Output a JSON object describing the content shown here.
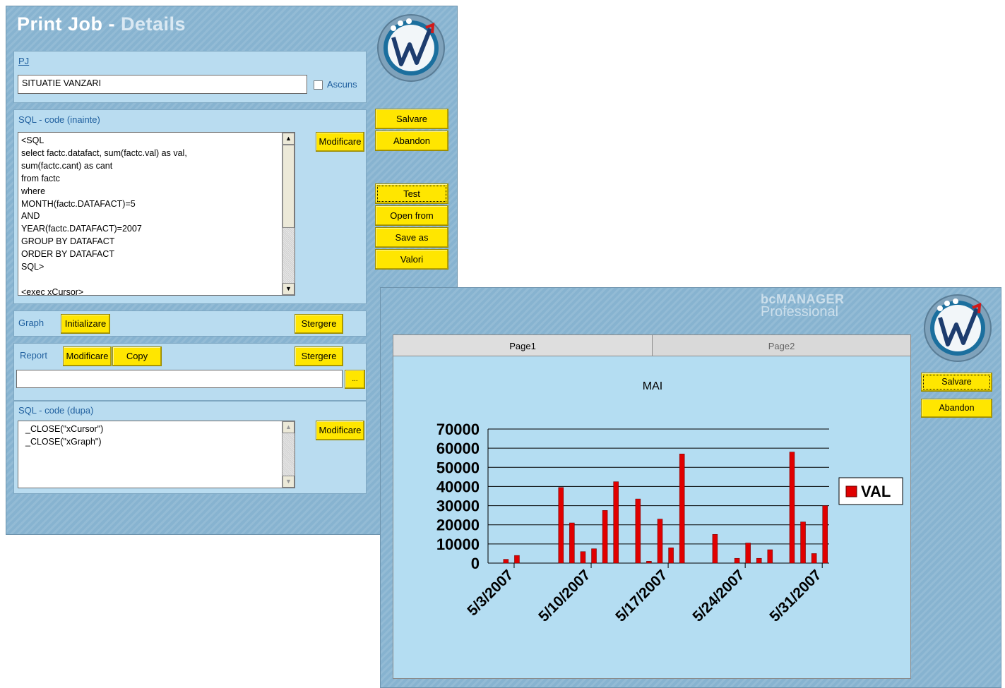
{
  "details_window": {
    "title_main": "Print Job - ",
    "title_dim": "Details",
    "pj_label": "PJ",
    "pj_value": "SITUATIE VANZARI",
    "hidden_label": "Ascuns",
    "sql_before_label": "SQL - code (inainte)",
    "sql_before_lines": [
      "<SQL",
      "select factc.datafact, sum(factc.val) as val,",
      "sum(factc.cant) as cant",
      "from factc",
      "where",
      "MONTH(factc.DATAFACT)=5",
      "AND",
      "YEAR(factc.DATAFACT)=2007",
      "GROUP BY DATAFACT",
      "ORDER BY DATAFACT",
      "SQL>",
      "",
      "<exec xCursor>"
    ],
    "modify_label": "Modificare",
    "graph_label": "Graph",
    "init_label": "Initializare",
    "delete_label": "Stergere",
    "report_label": "Report",
    "copy_label": "Copy",
    "report_path": "",
    "browse_label": "...",
    "sql_after_label": "SQL - code (dupa)",
    "sql_after_lines": [
      "_CLOSE(\"xCursor\")",
      "_CLOSE(\"xGraph\")"
    ],
    "side_buttons": {
      "save": "Salvare",
      "abandon": "Abandon",
      "test": "Test",
      "open_from": "Open from",
      "save_as": "Save as",
      "values": "Valori"
    }
  },
  "graph_window": {
    "brand_top": "bcMANAGER",
    "brand_bottom": "Professional",
    "tabs": [
      "Page1",
      "Page2"
    ],
    "save": "Salvare",
    "abandon": "Abandon"
  },
  "colors": {
    "window_bg": "#87b3d0",
    "panel_bg": "#b9dcf0",
    "button": "#ffe600",
    "bar": "#e00000",
    "label_blue": "#1f5f9e"
  },
  "chart_data": {
    "type": "bar",
    "title": "MAI",
    "ylim": [
      0,
      70000
    ],
    "y_ticks": [
      70000,
      60000,
      50000,
      40000,
      30000,
      20000,
      10000,
      0
    ],
    "x_tick_labels": [
      "5/3/2007",
      "5/10/2007",
      "5/17/2007",
      "5/24/2007",
      "5/31/2007"
    ],
    "legend": "top-right",
    "grid": true,
    "series": [
      {
        "name": "VAL",
        "points": [
          {
            "x": "5/2/2007",
            "y": 2000
          },
          {
            "x": "5/3/2007",
            "y": 4000
          },
          {
            "x": "5/7/2007",
            "y": 39500
          },
          {
            "x": "5/8/2007",
            "y": 21000
          },
          {
            "x": "5/9/2007",
            "y": 6000
          },
          {
            "x": "5/10/2007",
            "y": 7500
          },
          {
            "x": "5/11/2007",
            "y": 27500
          },
          {
            "x": "5/12/2007",
            "y": 42500
          },
          {
            "x": "5/14/2007",
            "y": 33500
          },
          {
            "x": "5/15/2007",
            "y": 1000
          },
          {
            "x": "5/16/2007",
            "y": 23000
          },
          {
            "x": "5/17/2007",
            "y": 8000
          },
          {
            "x": "5/18/2007",
            "y": 57000
          },
          {
            "x": "5/21/2007",
            "y": 15000
          },
          {
            "x": "5/23/2007",
            "y": 2500
          },
          {
            "x": "5/24/2007",
            "y": 10500
          },
          {
            "x": "5/25/2007",
            "y": 2500
          },
          {
            "x": "5/26/2007",
            "y": 7000
          },
          {
            "x": "5/28/2007",
            "y": 58000
          },
          {
            "x": "5/29/2007",
            "y": 21500
          },
          {
            "x": "5/30/2007",
            "y": 5000
          },
          {
            "x": "5/31/2007",
            "y": 30000
          }
        ]
      }
    ]
  }
}
